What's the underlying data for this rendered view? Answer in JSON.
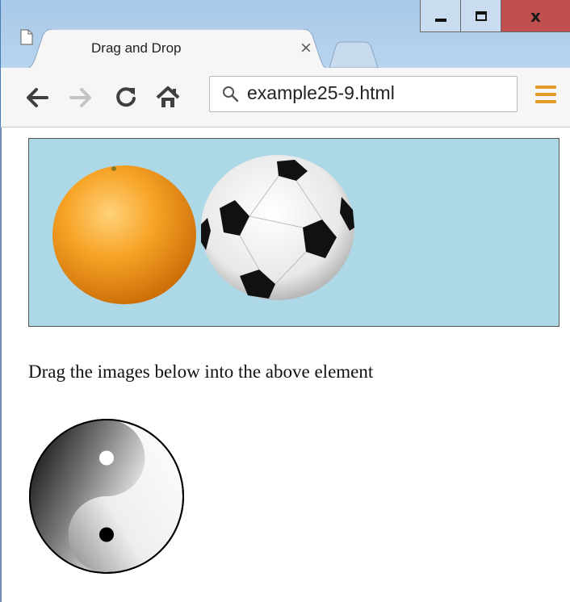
{
  "window": {
    "controls": {
      "minimize": "minimize",
      "maximize": "maximize",
      "close": "x"
    }
  },
  "tab": {
    "title": "Drag and Drop",
    "close": "×"
  },
  "toolbar": {
    "url": "example25-9.html"
  },
  "page": {
    "instructions": "Drag the images below into the above element",
    "dropzone_color": "#add8e6",
    "images": {
      "dropzone": [
        "orange-image",
        "soccer-ball-image"
      ],
      "below": [
        "yin-yang-image"
      ]
    }
  },
  "icons": [
    "page-icon",
    "back-arrow-icon",
    "forward-arrow-icon",
    "reload-icon",
    "home-icon",
    "search-icon",
    "menu-icon"
  ]
}
